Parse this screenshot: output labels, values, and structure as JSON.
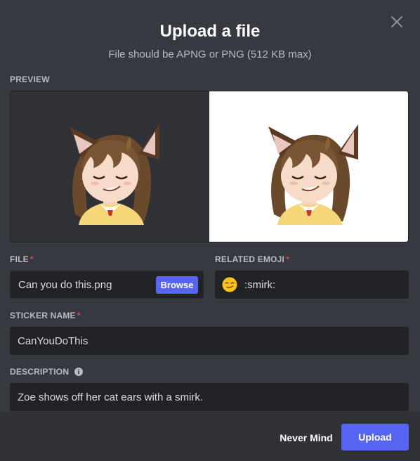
{
  "dialog": {
    "title": "Upload a file",
    "subtitle": "File should be APNG or PNG (512 KB max)"
  },
  "preview": {
    "label": "PREVIEW"
  },
  "file": {
    "label": "FILE",
    "required_mark": "*",
    "value": "Can you do this.png",
    "browse_label": "Browse"
  },
  "related_emoji": {
    "label": "RELATED EMOJI",
    "required_mark": "*",
    "value": ":smirk:",
    "emoji_icon": "smirk-emoji-icon"
  },
  "sticker_name": {
    "label": "STICKER NAME",
    "required_mark": "*",
    "value": "CanYouDoThis"
  },
  "description": {
    "label": "DESCRIPTION",
    "info_icon": "info-icon",
    "value": "Zoe shows off her cat ears with a smirk."
  },
  "footer": {
    "cancel_label": "Never Mind",
    "upload_label": "Upload"
  },
  "colors": {
    "background": "#36393f",
    "footer": "#2f3136",
    "input": "#202225",
    "accent": "#5865f2",
    "required": "#ed4245"
  }
}
